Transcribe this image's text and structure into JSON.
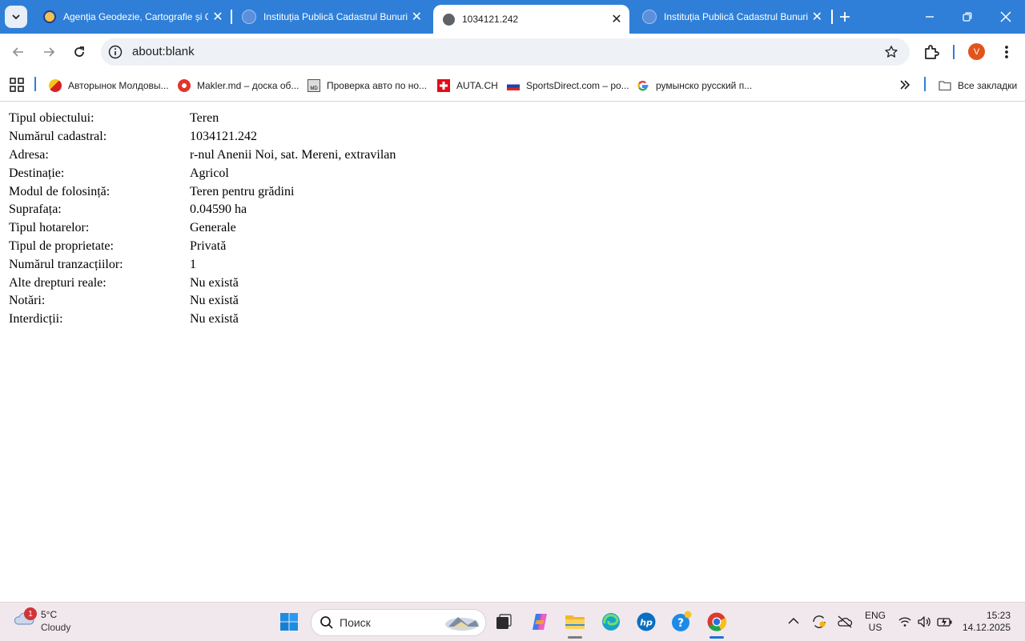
{
  "browser": {
    "tabs": [
      {
        "title": "Agenția Geodezie, Cartografie și Cadastru",
        "active": false
      },
      {
        "title": "Instituția Publică Cadastrul Bunurilor Imobile",
        "active": false
      },
      {
        "title": "1034121.242",
        "active": true
      },
      {
        "title": "Instituția Publică Cadastrul Bunurilor Imobile",
        "active": false
      }
    ],
    "address": "about:blank",
    "profile_initial": "V",
    "accent_color": "#2f7fd8"
  },
  "bookmarks": {
    "items": [
      {
        "label": "Авторынок Молдовы...",
        "icon": "avtorynok-icon"
      },
      {
        "label": "Makler.md – доска об...",
        "icon": "makler-icon"
      },
      {
        "label": "Проверка авто по но...",
        "icon": "md-plate-icon"
      },
      {
        "label": "AUTA.CH",
        "icon": "swiss-flag-icon"
      },
      {
        "label": "SportsDirect.com – ро...",
        "icon": "sportsdirect-icon"
      },
      {
        "label": "румынско русский п...",
        "icon": "google-icon"
      }
    ],
    "all_bookmarks": "Все закладки"
  },
  "details": {
    "rows": [
      {
        "label": "Tipul obiectului:",
        "value": "Teren"
      },
      {
        "label": "Numărul cadastral:",
        "value": "1034121.242"
      },
      {
        "label": "Adresa:",
        "value": "r-nul Anenii Noi, sat. Mereni, extravilan"
      },
      {
        "label": "Destinație:",
        "value": "Agricol"
      },
      {
        "label": "Modul de folosință:",
        "value": "Teren pentru grădini"
      },
      {
        "label": "Suprafața:",
        "value": "0.04590 ha"
      },
      {
        "label": "Tipul hotarelor:",
        "value": "Generale"
      },
      {
        "label": "Tipul de proprietate:",
        "value": "Privată"
      },
      {
        "label": "Numărul tranzacțiilor:",
        "value": "1"
      },
      {
        "label": "Alte drepturi reale:",
        "value": "Nu există"
      },
      {
        "label": "Notări:",
        "value": "Nu există"
      },
      {
        "label": "Interdicții:",
        "value": "Nu există"
      }
    ]
  },
  "taskbar": {
    "weather_badge": "1",
    "temperature": "5°C",
    "condition": "Cloudy",
    "search_placeholder": "Поиск",
    "lang_line1": "ENG",
    "lang_line2": "US",
    "time": "15:23",
    "date": "14.12.2025"
  }
}
